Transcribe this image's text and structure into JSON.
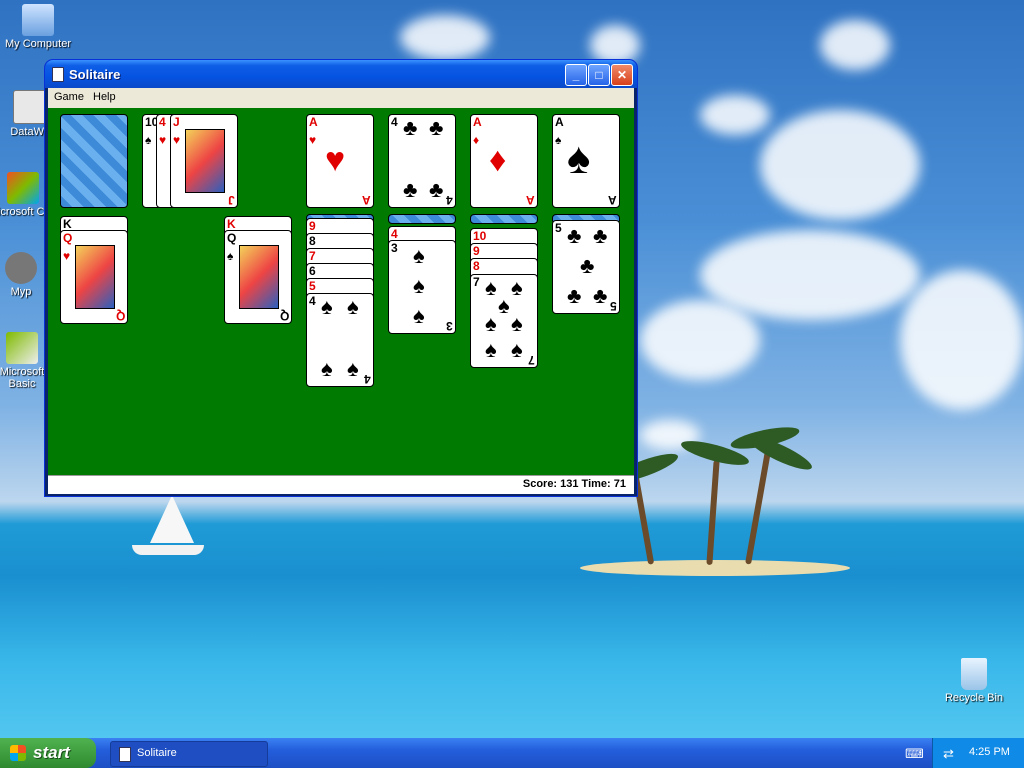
{
  "desktop": {
    "icons": [
      {
        "label": "My Computer"
      },
      {
        "label": "DataWa"
      },
      {
        "label": "Microsoft C++"
      },
      {
        "label": "Myp"
      },
      {
        "label": "Microsoft Basic"
      },
      {
        "label": "Recycle Bin"
      }
    ]
  },
  "window": {
    "title": "Solitaire",
    "minimize_glyph": "_",
    "maximize_glyph": "□",
    "close_glyph": "✕",
    "menu": [
      "Game",
      "Help"
    ],
    "status": "Score: 131 Time: 71"
  },
  "cards": {
    "waste": [
      {
        "rank": "10",
        "suit": "♠",
        "color": "black"
      },
      {
        "rank": "4",
        "suit": "♥",
        "color": "red"
      },
      {
        "rank": "J",
        "suit": "♥",
        "color": "red"
      }
    ],
    "foundations": [
      {
        "rank": "A",
        "suit": "♥",
        "color": "red"
      },
      {
        "rank": "4",
        "suit": "♣",
        "color": "black"
      },
      {
        "rank": "A",
        "suit": "♦",
        "color": "red"
      },
      {
        "rank": "A",
        "suit": "♠",
        "color": "black"
      }
    ],
    "tableau": [
      [
        {
          "rank": "K",
          "suit": "♣",
          "color": "black"
        },
        {
          "rank": "Q",
          "suit": "♥",
          "color": "red"
        }
      ],
      [],
      [
        {
          "rank": "K",
          "suit": "♥",
          "color": "red"
        },
        {
          "rank": "Q",
          "suit": "♠",
          "color": "black"
        }
      ],
      [
        {
          "rank": "9",
          "suit": "♥",
          "color": "red"
        },
        {
          "rank": "8",
          "suit": "♠",
          "color": "black"
        },
        {
          "rank": "7",
          "suit": "♥",
          "color": "red"
        },
        {
          "rank": "6",
          "suit": "♠",
          "color": "black"
        },
        {
          "rank": "5",
          "suit": "♥",
          "color": "red"
        },
        {
          "rank": "4",
          "suit": "♠",
          "color": "black"
        }
      ],
      [
        {
          "rank": "4",
          "suit": "♥",
          "color": "red"
        },
        {
          "rank": "3",
          "suit": "♠",
          "color": "black"
        }
      ],
      [
        {
          "rank": "10",
          "suit": "♥",
          "color": "red"
        },
        {
          "rank": "9",
          "suit": "♥",
          "color": "red"
        },
        {
          "rank": "8",
          "suit": "♥",
          "color": "red"
        },
        {
          "rank": "7",
          "suit": "♠",
          "color": "black"
        }
      ],
      [
        {
          "rank": "5",
          "suit": "♣",
          "color": "black"
        }
      ]
    ]
  },
  "taskbar": {
    "start_label": "start",
    "tasks": [
      {
        "label": "Solitaire"
      }
    ],
    "clock": "4:25 PM"
  },
  "colors": {
    "felt": "#007a00",
    "titlebar": "#0553e1",
    "taskbar": "#245edb",
    "start": "#2f8a2f"
  }
}
